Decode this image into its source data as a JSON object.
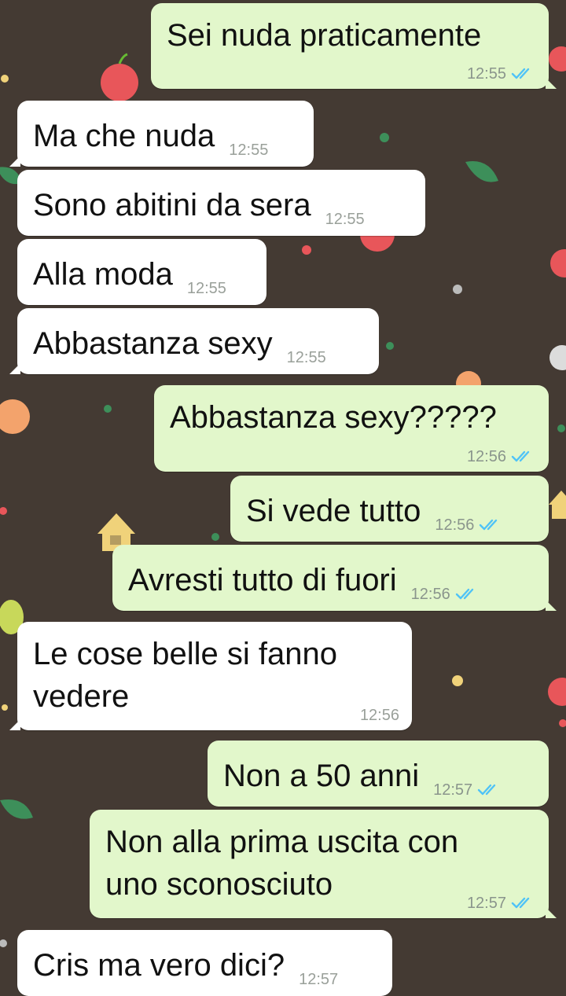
{
  "colors": {
    "wallpaper": "#443a33",
    "incoming_bubble": "#ffffff",
    "outgoing_bubble": "#e2f7cb",
    "read_ticks": "#4fc3f7",
    "time_text": "#8a958c"
  },
  "messages": [
    {
      "direction": "outgoing",
      "text": "Sei nuda praticamente",
      "time": "12:55",
      "status": "read"
    },
    {
      "direction": "incoming",
      "text": "Ma che nuda",
      "time": "12:55"
    },
    {
      "direction": "incoming",
      "text": "Sono abitini da sera",
      "time": "12:55"
    },
    {
      "direction": "incoming",
      "text": "Alla moda",
      "time": "12:55"
    },
    {
      "direction": "incoming",
      "text": "Abbastanza sexy",
      "time": "12:55"
    },
    {
      "direction": "outgoing",
      "text": "Abbastanza sexy?????",
      "time": "12:56",
      "status": "read"
    },
    {
      "direction": "outgoing",
      "text": "Si vede tutto",
      "time": "12:56",
      "status": "read"
    },
    {
      "direction": "outgoing",
      "text": "Avresti tutto di fuori",
      "time": "12:56",
      "status": "read"
    },
    {
      "direction": "incoming",
      "text": "Le cose belle si fanno\nvedere",
      "time": "12:56"
    },
    {
      "direction": "outgoing",
      "text": "Non a 50 anni",
      "time": "12:57",
      "status": "read"
    },
    {
      "direction": "outgoing",
      "text": "Non alla prima uscita con\nuno sconosciuto",
      "time": "12:57",
      "status": "read"
    },
    {
      "direction": "incoming",
      "text": "Cris ma vero dici?",
      "time": "12:57"
    }
  ],
  "icons": {
    "read_receipt": "double-check-icon",
    "wallpaper_decor": [
      "apple-icon",
      "leaf-icon",
      "house-icon",
      "pear-icon",
      "dot-icon"
    ]
  }
}
